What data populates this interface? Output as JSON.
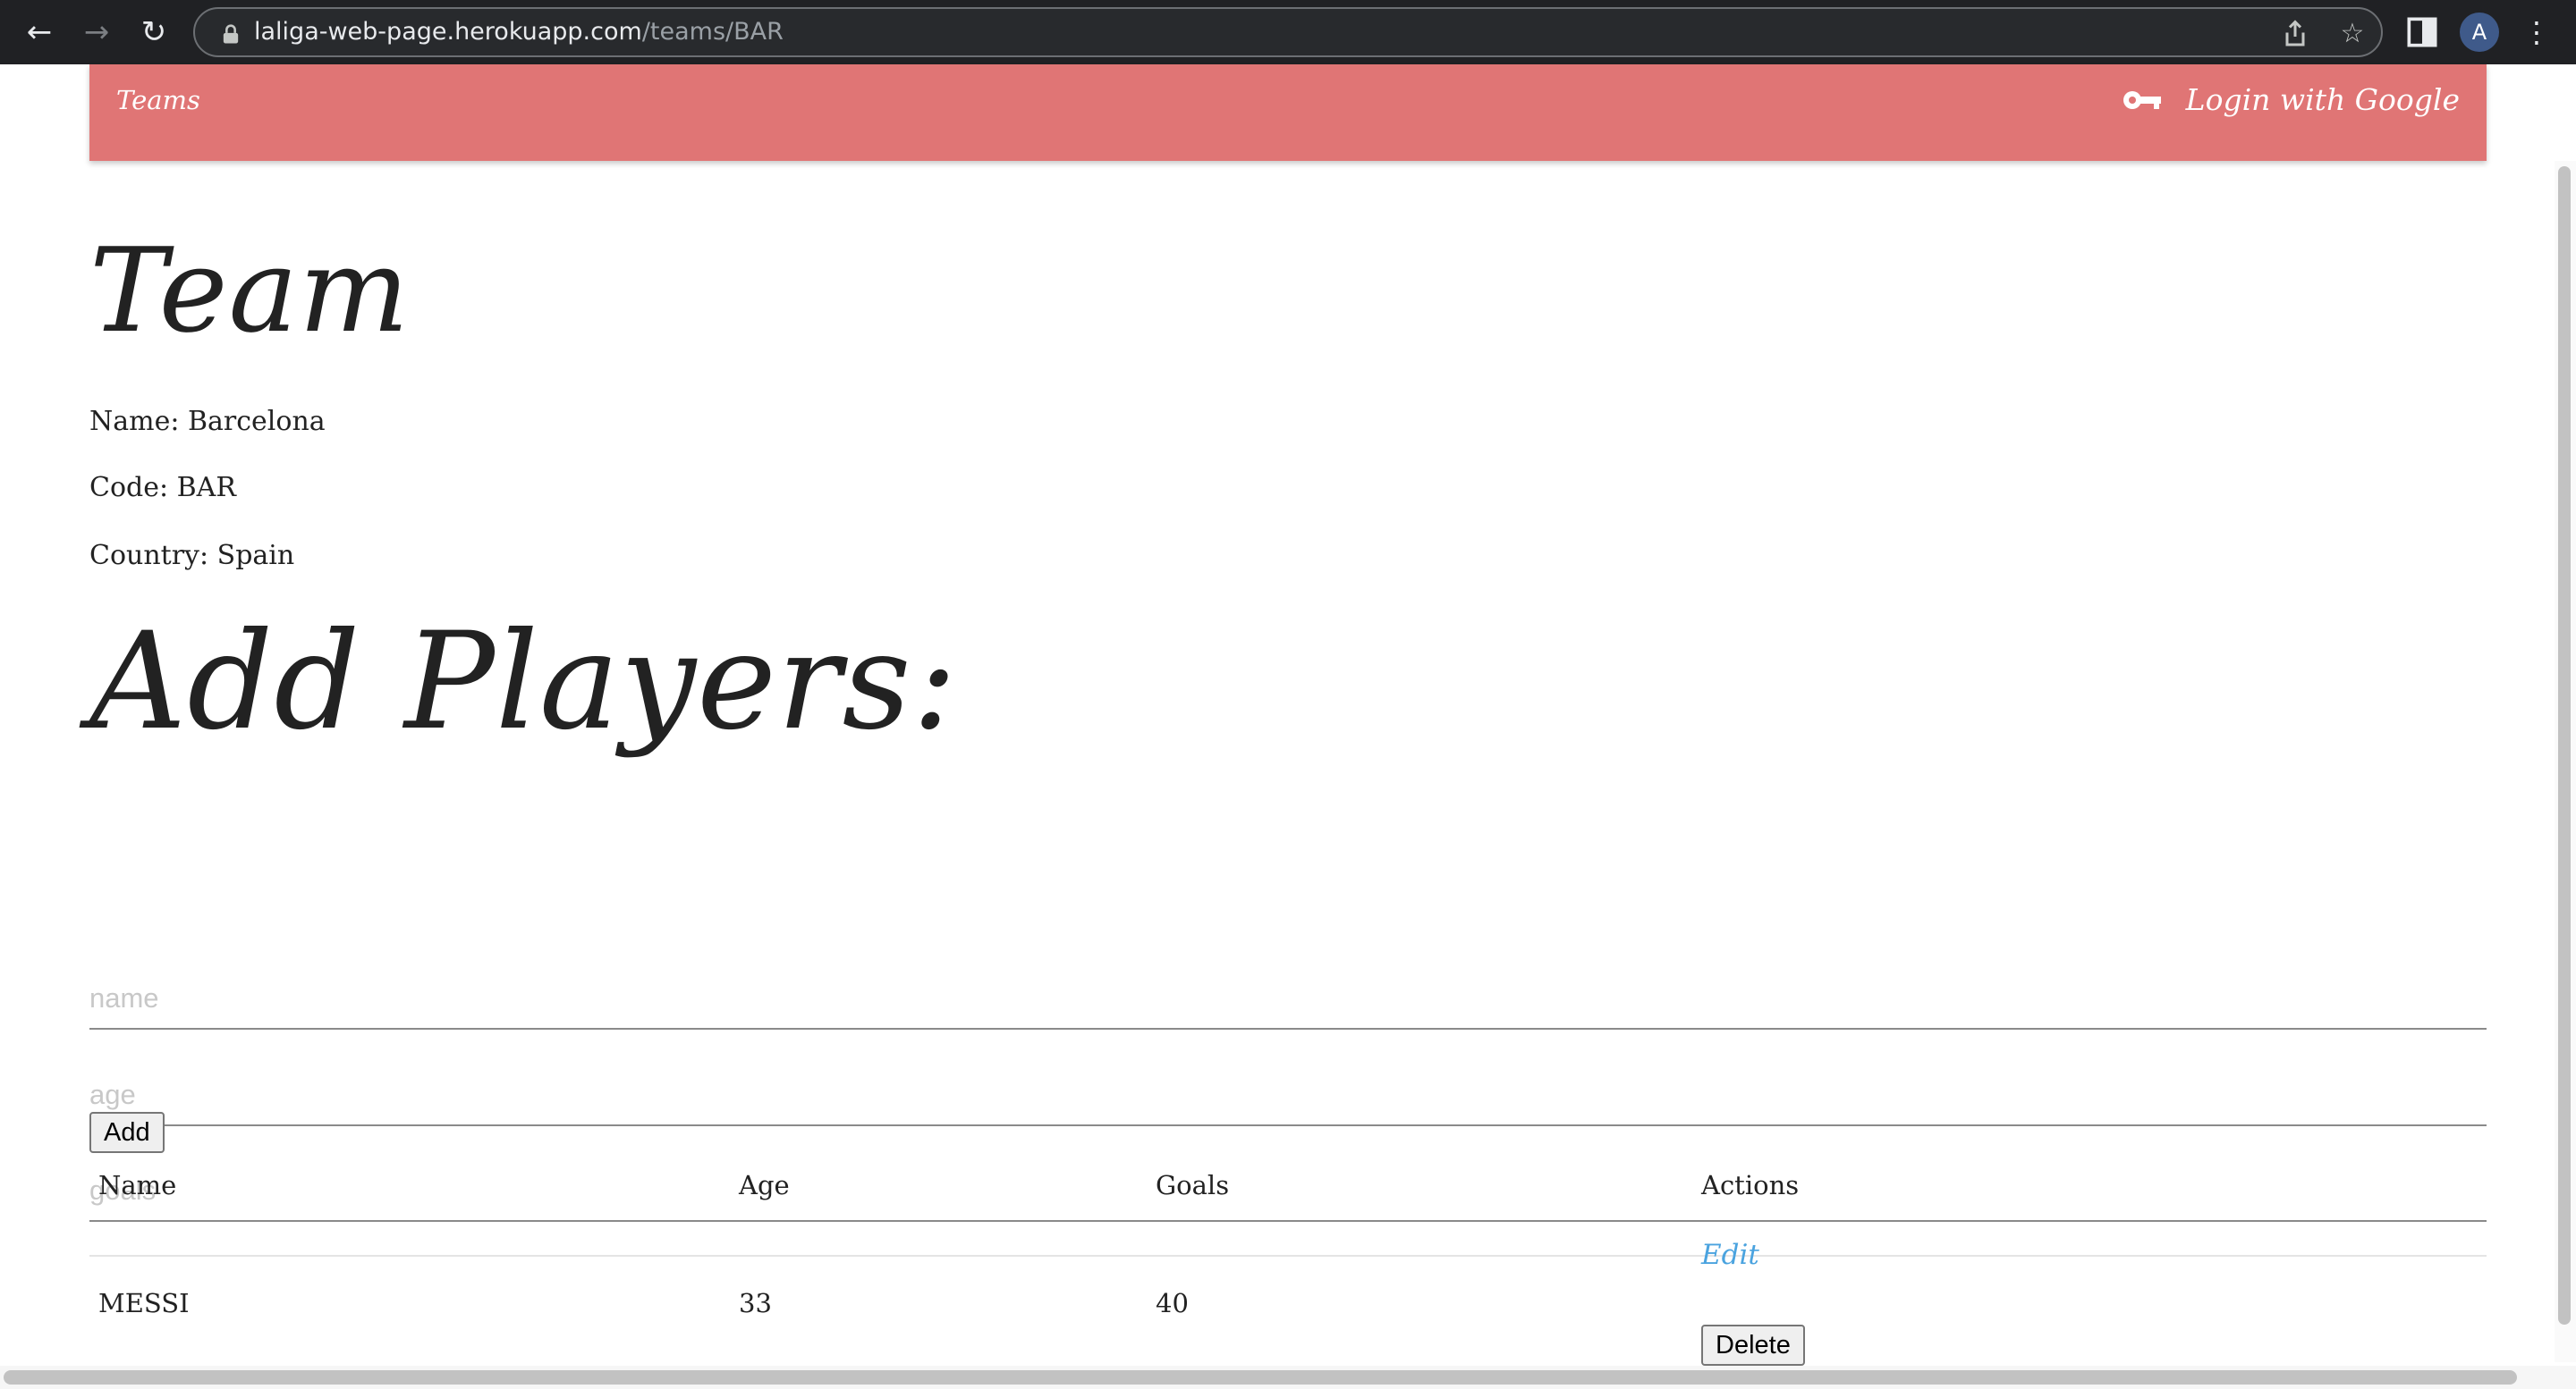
{
  "browser": {
    "url_host": "laliga-web-page.herokuapp.com",
    "url_path": "/teams/BAR",
    "profile_initial": "A"
  },
  "navbar": {
    "teams_link": "Teams",
    "login_label": "Login with Google",
    "background": "#e07575"
  },
  "team": {
    "heading": "Team",
    "name_line": "Name: Barcelona",
    "code_line": "Code: BAR",
    "country_line": "Country: Spain"
  },
  "add_players": {
    "heading": "Add Players:",
    "name_placeholder": "name",
    "age_placeholder": "age",
    "goals_placeholder": "goals",
    "add_button": "Add"
  },
  "players_table": {
    "columns": [
      "Name",
      "Age",
      "Goals",
      "Actions"
    ],
    "rows": [
      {
        "name": "MESSI",
        "age": "33",
        "goals": "40",
        "edit_label": "Edit",
        "delete_label": "Delete"
      }
    ]
  },
  "colors": {
    "link": "#4aa3df"
  }
}
